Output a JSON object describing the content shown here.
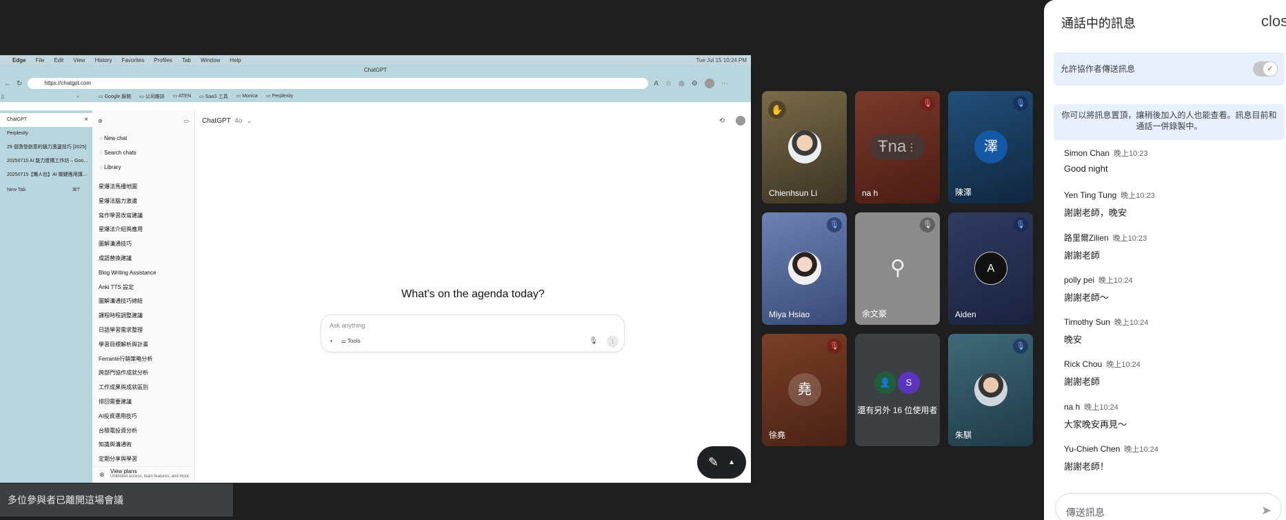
{
  "mac": {
    "menu": [
      "Edge",
      "File",
      "Edit",
      "View",
      "History",
      "Favorites",
      "Profiles",
      "Tab",
      "Window",
      "Help"
    ],
    "clock": "Tue Jul 15  10:24 PM"
  },
  "browser": {
    "window_title": "ChatGPT",
    "url": "https://chatgpt.com",
    "bookmarks": [
      "Google 服務",
      "公司雜誌",
      "ATEN",
      "SaaS 工具",
      "Monica",
      "Perplexity"
    ],
    "tabs": [
      "ChatGPT",
      "Perplexity",
      "29 個激發創意的腦力激盪技巧 [2025]",
      "20250715 AI 能力建構工作坊 – Goo...",
      "20250715【懶人包】AI 關鍵應用講..."
    ],
    "new_tab": "New Tab",
    "new_tab_shortcut": "⌘T"
  },
  "chatgpt": {
    "actions": [
      "New chat",
      "Search chats",
      "Library"
    ],
    "chats": [
      "星爆法馬播地圖",
      "星爆法腦力激盪",
      "寫作學習改寫建議",
      "星爆法介紹與應用",
      "圖解溝通技巧",
      "成語替換建議",
      "Blog Writing Assistance",
      "Anki TTS 設定",
      "圖解溝通技巧總結",
      "課程時程調整建議",
      "日語學習需求整理",
      "學習目標解析與計畫",
      "Ferrante行銷策略分析",
      "跨部門協作成就分析",
      "工作成果與成就區別",
      "排回需要建議",
      "AI投資運用技巧",
      "台積電投資分析",
      "知識與溝通術",
      "定期分享與學習"
    ],
    "view_plans": "View plans",
    "view_plans_sub": "Unlimited access, team features, and more",
    "model_title": "ChatGPT",
    "model_version": "4o",
    "headline": "What's on the agenda today?",
    "input_placeholder": "Ask anything",
    "tools_label": "Tools"
  },
  "toast": "多位參與者已離開這場會議",
  "tiles": [
    {
      "name": "Chienhsun Li"
    },
    {
      "name": "na h",
      "pill_text": "Ŧna"
    },
    {
      "name": "陳澤",
      "letter": "澤"
    },
    {
      "name": "Miya Hsiao"
    },
    {
      "name": "余文豪"
    },
    {
      "name": "Aiden",
      "letter": "A"
    },
    {
      "name": "徐堯",
      "letter": "堯"
    },
    {
      "others_text": "還有另外 16 位使用者",
      "mini_letter": "S"
    },
    {
      "name": "朱騏"
    }
  ],
  "panel": {
    "title": "通話中的訊息",
    "close_label": "clos",
    "allow_label": "允許協作者傳送訊息",
    "notice": "你可以將訊息置頂，讓稍後加入的人也能查看。訊息目前和通話一併錄製中。",
    "messages": [
      {
        "who": "Simon Chan",
        "time": "晚上10:23",
        "text": "Good night"
      },
      {
        "who": "Yen Ting Tung",
        "time": "晚上10:23",
        "text": "謝謝老師，晚安"
      },
      {
        "who": "路里爾Zilien",
        "time": "晚上10:23",
        "text": "謝謝老師"
      },
      {
        "who": "polly pei",
        "time": "晚上10:24",
        "text": "謝謝老師～"
      },
      {
        "who": "Timothy Sun",
        "time": "晚上10:24",
        "text": "晚安"
      },
      {
        "who": "Rick Chou",
        "time": "晚上10:24",
        "text": "謝謝老師"
      },
      {
        "who": "na h",
        "time": "晚上10:24",
        "text": "大家晚安再見～"
      },
      {
        "who": "Yu-Chieh Chen",
        "time": "晚上10:24",
        "text": "謝謝老師！"
      }
    ],
    "send_placeholder": "傳送訊息"
  }
}
